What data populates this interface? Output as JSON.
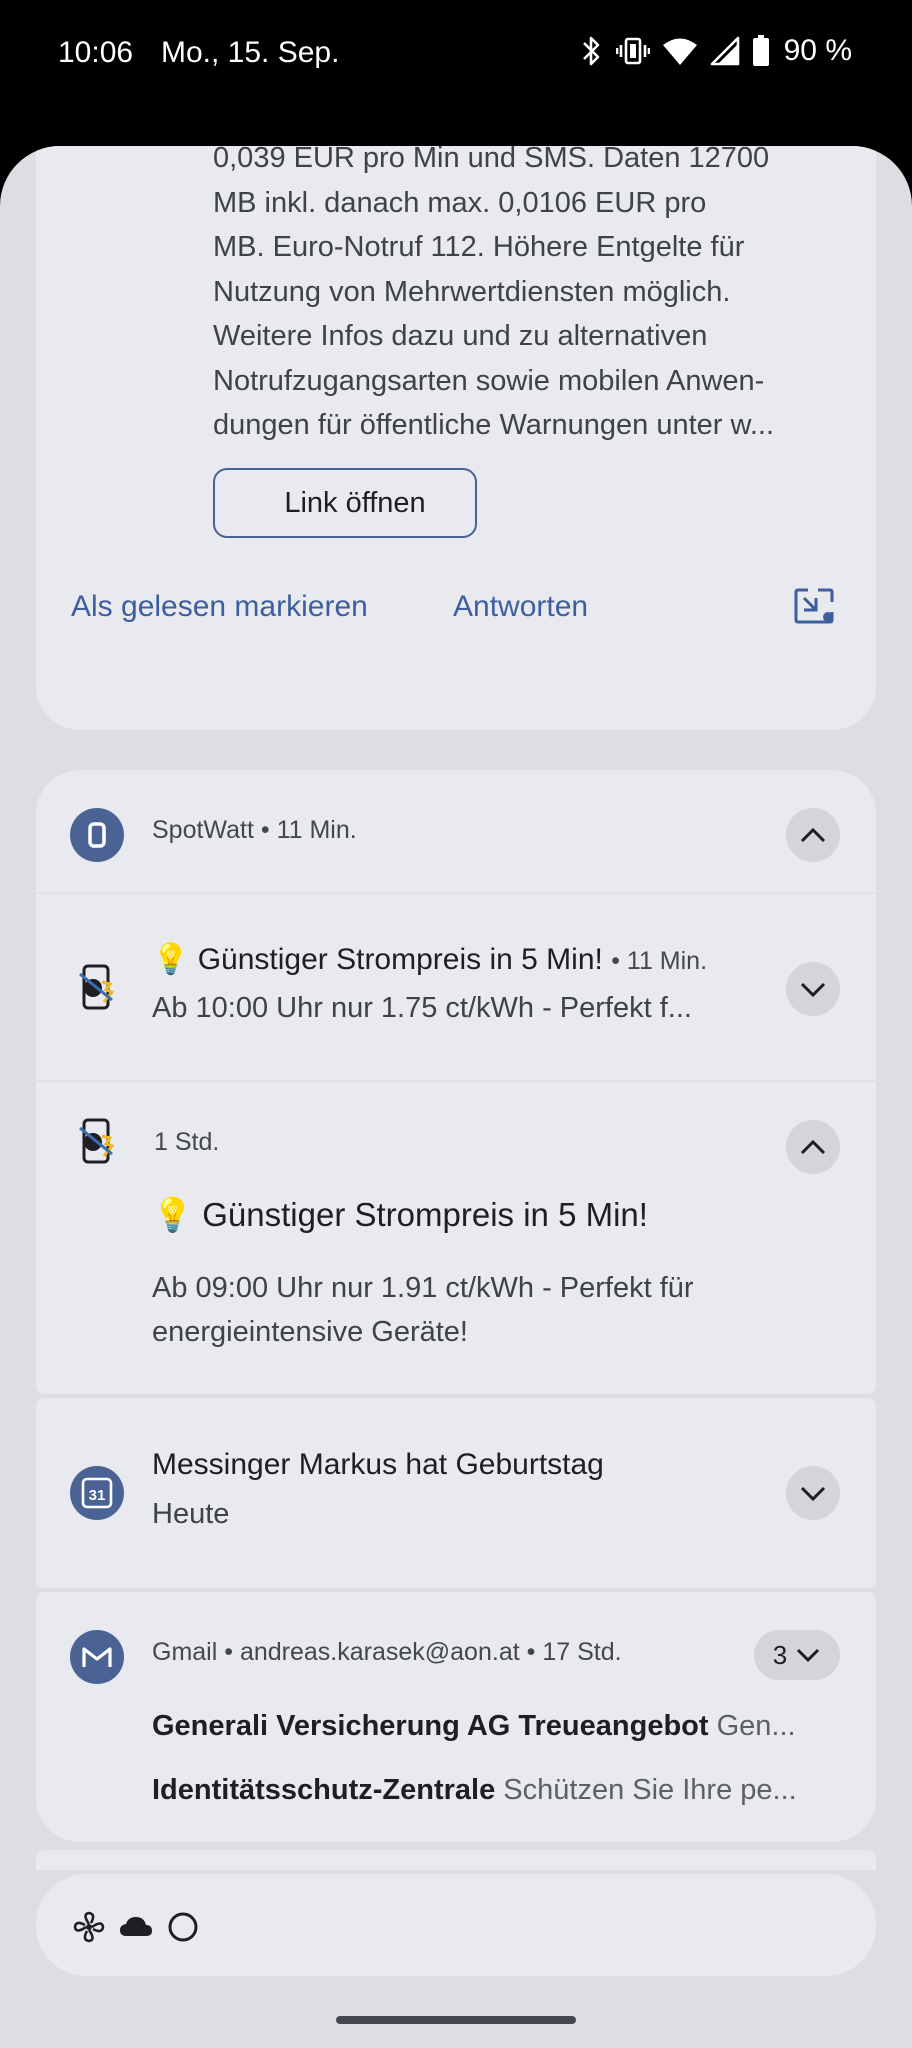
{
  "status_bar": {
    "time": "10:06",
    "date": "Mo., 15. Sep.",
    "battery": "90 %",
    "icons": [
      "bluetooth-icon",
      "vibrate-icon",
      "wifi-icon",
      "signal-icon",
      "battery-icon"
    ]
  },
  "sms_card": {
    "body_lines": [
      "0,039 EUR pro Min und SMS. Daten 12700",
      "MB inkl. danach max. 0,0106 EUR pro",
      "MB. Euro-Notruf 112. Höhere Entgelte für",
      "Nutzung von Mehrwertdiensten möglich.",
      "Weitere Infos dazu und zu alternativen",
      "Notrufzugangsarten sowie mobilen Anwen-",
      "dungen für öffentliche Warnungen unter w..."
    ],
    "link_button": "Link öffnen",
    "action_mark_read": "Als gelesen markieren",
    "action_reply": "Antworten"
  },
  "spotwatt_group": {
    "app_name": "SpotWatt",
    "time": "11 Min.",
    "notifications": [
      {
        "emoji": "💡",
        "title": "Günstiger Strompreis in 5 Min!",
        "time": "11 Min.",
        "text": "Ab 10:00 Uhr nur 1.75 ct/kWh - Perfekt f..."
      },
      {
        "emoji": "💡",
        "time": "1 Std.",
        "title": "Günstiger Strompreis in 5 Min!",
        "text": "Ab 09:00 Uhr nur 1.91 ct/kWh - Perfekt für energieintensive Geräte!"
      }
    ]
  },
  "birthday": {
    "calendar_day": "31",
    "title": "Messinger Markus hat Geburtstag",
    "subtitle": "Heute"
  },
  "gmail": {
    "app_name": "Gmail",
    "account": "andreas.karasek@aon.at",
    "time": "17 Std.",
    "count": "3",
    "messages": [
      {
        "sender": "Generali Versicherung AG Treueangebot",
        "preview": "Gen..."
      },
      {
        "sender": "Identitätsschutz-Zentrale",
        "preview": "Schützen Sie Ihre pe..."
      }
    ]
  },
  "colors": {
    "accent": "#4a6394",
    "link_text": "#3e5f9e",
    "shade_bg": "#dcdee3",
    "card_bg": "#e8eaef"
  }
}
